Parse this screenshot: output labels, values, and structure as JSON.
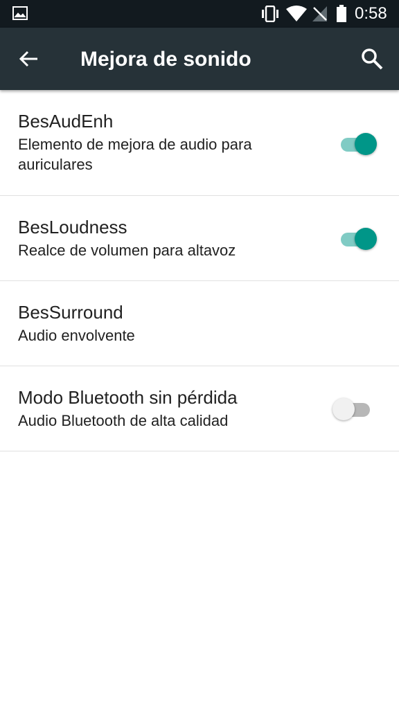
{
  "status_bar": {
    "time": "0:58",
    "icons": [
      "gallery-icon",
      "vibrate-icon",
      "wifi-icon",
      "no-signal-icon",
      "battery-icon"
    ]
  },
  "app_bar": {
    "title": "Mejora de sonido",
    "back_icon": "arrow-back-icon",
    "search_icon": "search-icon",
    "background": "#263238"
  },
  "preferences": [
    {
      "title": "BesAudEnh",
      "summary": "Elemento de mejora de audio para auriculares",
      "switch": "on"
    },
    {
      "title": "BesLoudness",
      "summary": "Realce de volumen para altavoz",
      "switch": "on"
    },
    {
      "title": "BesSurround",
      "summary": "Audio envolvente",
      "switch": "none"
    },
    {
      "title": "Modo Bluetooth sin pérdida",
      "summary": "Audio Bluetooth de alta calidad",
      "switch": "off"
    }
  ],
  "colors": {
    "accent": "#009688",
    "accent_track": "#80cbc4",
    "status_bar": "#121a1f",
    "divider": "#e0e0e0"
  }
}
